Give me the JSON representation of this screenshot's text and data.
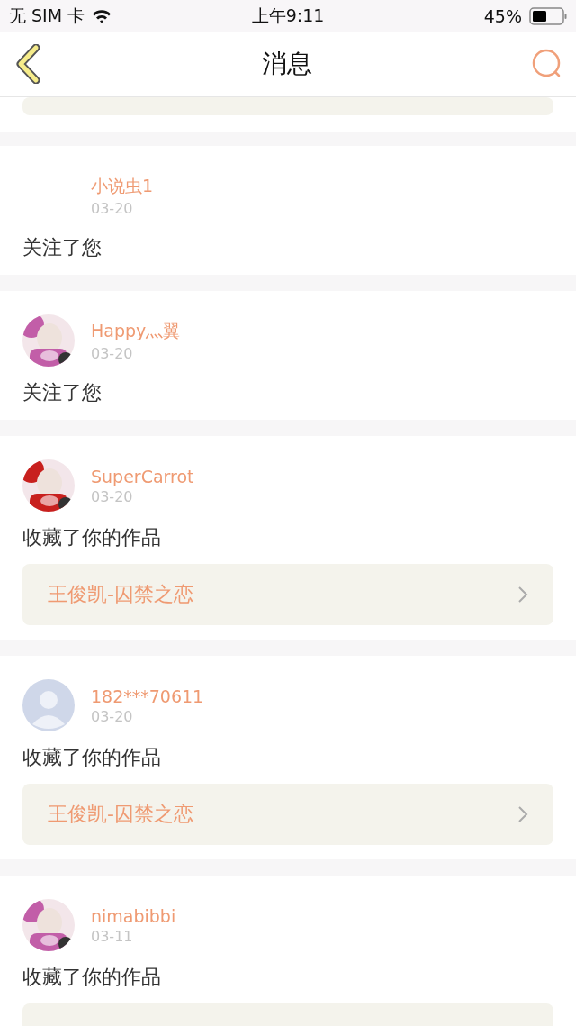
{
  "status_bar": {
    "carrier": "无 SIM 卡",
    "time": "上午9:11",
    "battery": "45%"
  },
  "nav": {
    "title": "消息"
  },
  "top_partial_card": {
    "kind": "card"
  },
  "messages": [
    {
      "avatar": {
        "kind": "none"
      },
      "name": "小说虫1",
      "date": "03-20",
      "action": "关注了您"
    },
    {
      "name": "Happy灬翼",
      "date": "03-20",
      "action": "关注了您"
    },
    {
      "name": "SuperCarrot",
      "date": "03-20",
      "action": "收藏了你的作品",
      "work": {
        "kind": "full",
        "title": "王俊凯-囚禁之恋"
      }
    },
    {
      "avatar": {
        "kind": "default"
      },
      "name": "182***70611",
      "date": "03-20",
      "action": "收藏了你的作品",
      "work": {
        "kind": "full",
        "title": "王俊凯-囚禁之恋"
      }
    },
    {
      "name": "nimabibbi",
      "date": "03-11",
      "action": "收藏了你的作品",
      "work": {
        "kind": "partial"
      }
    }
  ]
}
